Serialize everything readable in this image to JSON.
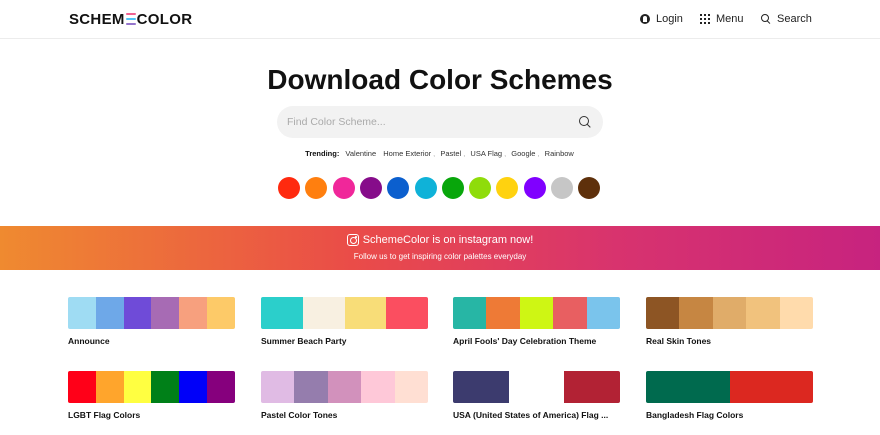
{
  "header": {
    "logo_left": "SCHEM",
    "logo_right": "COLOR",
    "logo_mark_colors": [
      "#f06292",
      "#4fc3f7",
      "#9575cd"
    ],
    "login_label": "Login",
    "menu_label": "Menu",
    "search_label": "Search"
  },
  "hero": {
    "title": "Download Color Schemes",
    "search_placeholder": "Find Color Scheme...",
    "trending_label": "Trending:",
    "trending": [
      "Valentine",
      "Home Exterior",
      "Pastel",
      "USA Flag",
      "Google",
      "Rainbow"
    ]
  },
  "color_swatches": [
    "#ff2a0f",
    "#ff7f0f",
    "#f0279a",
    "#860c8a",
    "#0b5fce",
    "#0fb2d8",
    "#08a60b",
    "#8fdc0a",
    "#ffd20f",
    "#8000ff",
    "#c6c6c6",
    "#5e300b"
  ],
  "banner": {
    "title": "SchemeColor is on instagram now!",
    "subtitle": "Follow us to get inspiring color palettes everyday"
  },
  "schemes": [
    {
      "name": "Announce",
      "colors": [
        "#9fdcf3",
        "#6ea8e8",
        "#6f4bd8",
        "#a76bb4",
        "#f7a07e",
        "#fdca68"
      ]
    },
    {
      "name": "Summer Beach Party",
      "colors": [
        "#2bcfcb",
        "#f8f0e1",
        "#f8dd78",
        "#fb4e60"
      ]
    },
    {
      "name": "April Fools' Day Celebration Theme",
      "colors": [
        "#27b6a5",
        "#ee7a36",
        "#cef614",
        "#e85f61",
        "#7ac4ec"
      ]
    },
    {
      "name": "Real Skin Tones",
      "colors": [
        "#8d5524",
        "#c68642",
        "#e0ac69",
        "#f1c27d",
        "#ffdbac"
      ]
    },
    {
      "name": "LGBT Flag Colors",
      "colors": [
        "#ff0018",
        "#ffa52c",
        "#ffff41",
        "#008018",
        "#0000f9",
        "#86007d"
      ]
    },
    {
      "name": "Pastel Color Tones",
      "colors": [
        "#e0bbe4",
        "#957dad",
        "#d291bc",
        "#fec8d8",
        "#ffdfd3"
      ]
    },
    {
      "name": "USA (United States of America) Flag ...",
      "colors": [
        "#3c3b6e",
        "#ffffff",
        "#b22234"
      ]
    },
    {
      "name": "Bangladesh Flag Colors",
      "colors": [
        "#006a4e",
        "#dc2820"
      ]
    }
  ]
}
